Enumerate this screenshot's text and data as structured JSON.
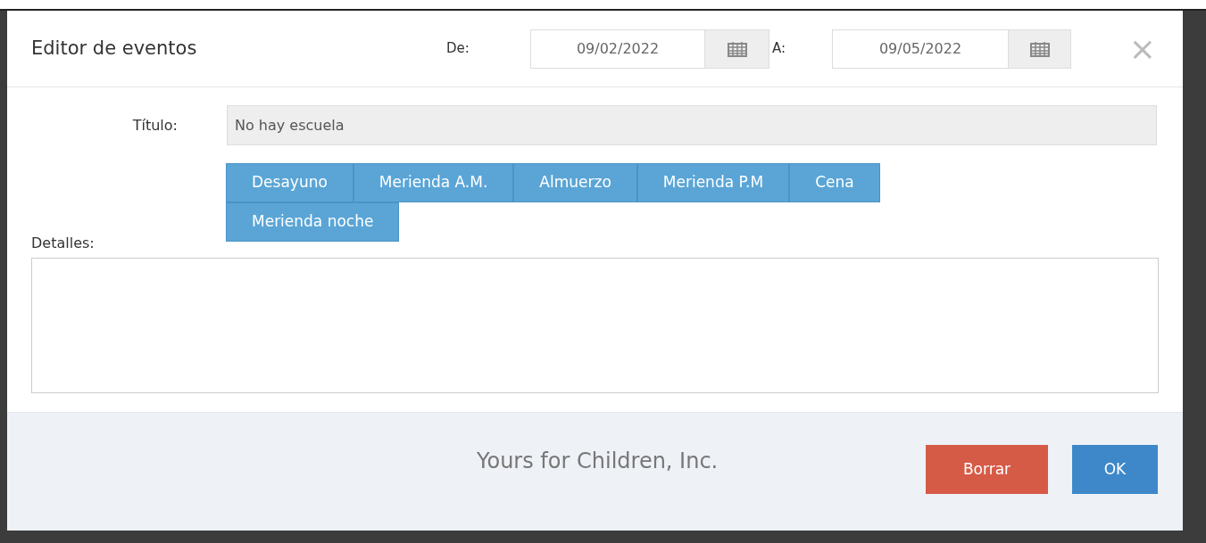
{
  "dialog": {
    "title": "Editor de eventos",
    "from_label": "De:",
    "from_date": "09/02/2022",
    "to_label": "A:",
    "to_date": "09/05/2022",
    "close": "×"
  },
  "form": {
    "title_label": "Título:",
    "title_value": "No hay escuela",
    "meal_buttons": [
      "Desayuno",
      "Merienda A.M.",
      "Almuerzo",
      "Merienda P.M",
      "Cena",
      "Merienda noche"
    ],
    "details_label": "Detalles:"
  },
  "footer": {
    "company": "Yours for Children, Inc.",
    "buttons": [
      {
        "label": "Borrar",
        "kind": "danger"
      },
      {
        "label": "OK",
        "kind": "primary"
      }
    ]
  }
}
